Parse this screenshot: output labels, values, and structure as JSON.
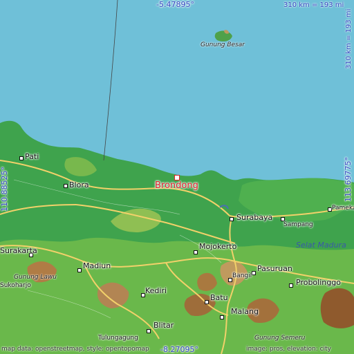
{
  "map": {
    "featured_place": "Brondong",
    "coords": {
      "top": "-5.47895°",
      "bottom": "-8.27095°",
      "left": "110.88525°",
      "right": "113.69775°"
    },
    "scale": {
      "top": "310 km = 193 mi",
      "right": "310 km = 193 mi"
    },
    "sea_label": "Selat Madura",
    "cities": [
      "Pati",
      "Blora",
      "Surabaya",
      "Sampang",
      "Pameka",
      "Surakarta",
      "Madiun",
      "Mojokerto",
      "Pasuruan",
      "Probolinggo",
      "Sukoharjo",
      "Kediri",
      "Bangil",
      "Batu",
      "Malang",
      "Blitar",
      "Tulungagung"
    ],
    "mountains": [
      "Gunung Besar",
      "Gunung Lawu",
      "Gunung Semeru"
    ],
    "attribution": {
      "left": "map data: openstreetmap, style: opentopomap",
      "right": "image: pros, elevation: city"
    },
    "colors": {
      "sea": "#6fc0d8",
      "lowland": "#3fa34d",
      "highland": "#c9a36a",
      "road": "#f2d16a",
      "marker": "#e0202a",
      "coord_text": "#3148c0"
    }
  }
}
